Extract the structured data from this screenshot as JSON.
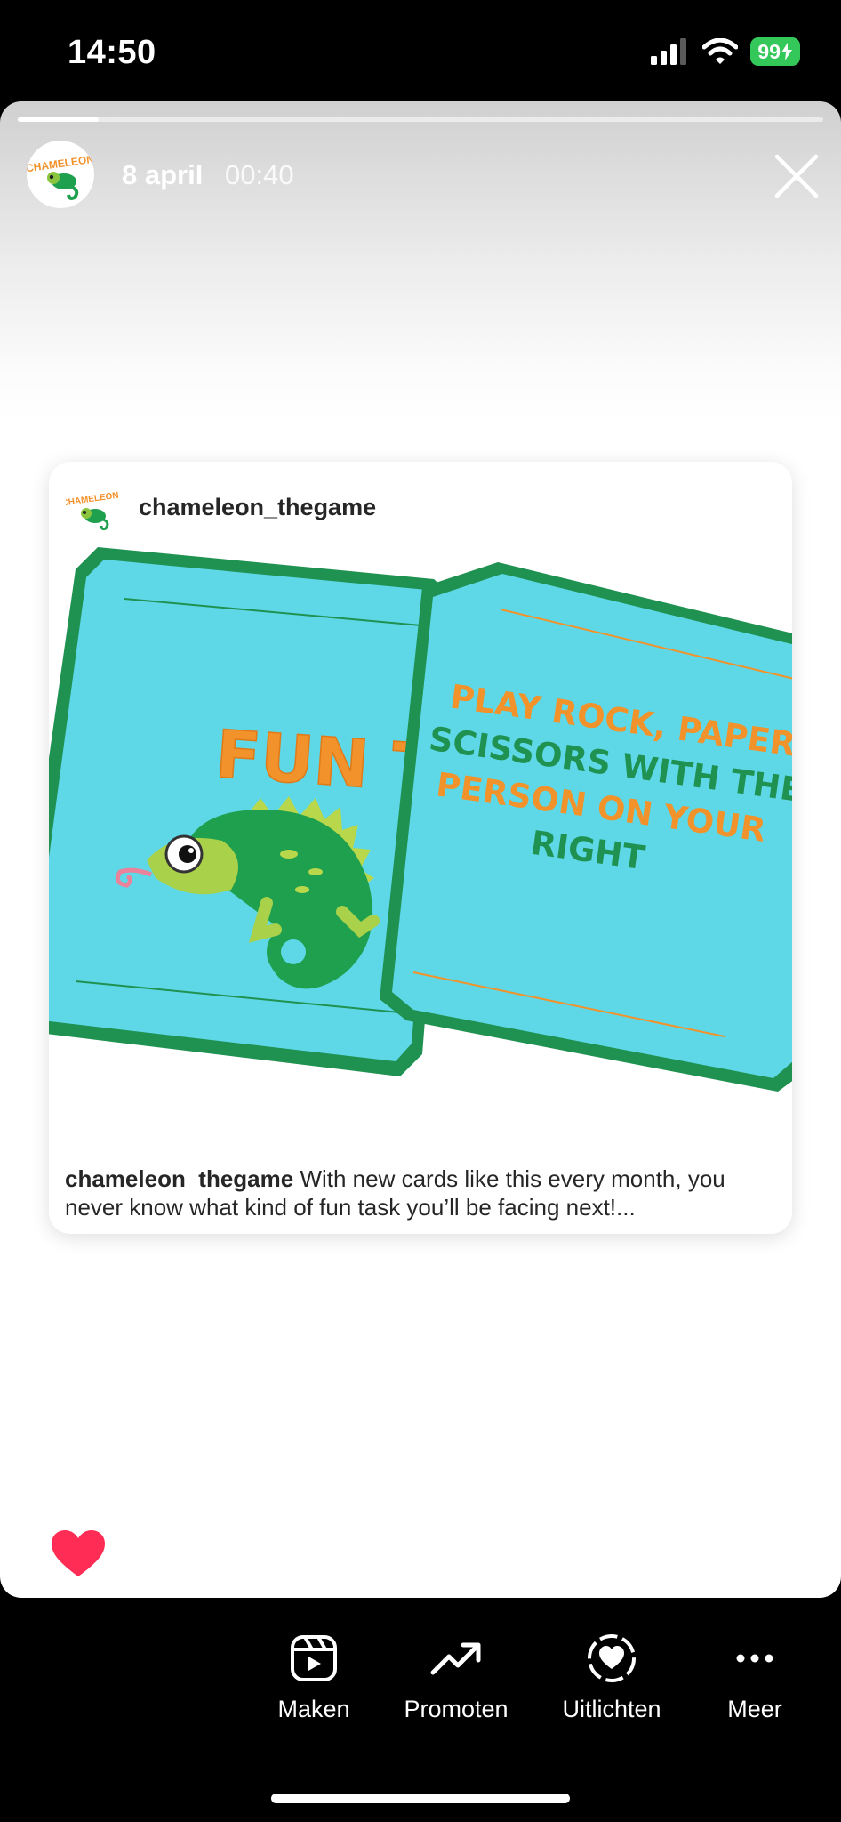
{
  "status_bar": {
    "time": "14:50",
    "battery": "99"
  },
  "story": {
    "progress": 0.1,
    "date": "8 april",
    "duration": "00:40",
    "avatar_alt": "CHAMELEON"
  },
  "post": {
    "username": "chameleon_thegame",
    "caption_user": "chameleon_thegame",
    "caption_text": " With new cards like this every month, you never know what kind of fun task you’ll be facing next!...",
    "card_left_title": "FUN TASK",
    "card_right_lines": [
      "PLAY ROCK, PAPER,",
      "SCISSORS WITH THE",
      "PERSON ON YOUR",
      "RIGHT"
    ]
  },
  "toolbar": {
    "items": [
      {
        "label": "Maken",
        "icon": "reels-icon"
      },
      {
        "label": "Promoten",
        "icon": "trending-icon"
      },
      {
        "label": "Uitlichten",
        "icon": "highlight-icon"
      },
      {
        "label": "Meer",
        "icon": "more-icon"
      }
    ]
  },
  "colors": {
    "card_fill": "#5ed8e6",
    "card_border": "#1f9150",
    "orange": "#f2922b",
    "heart": "#ff2d55",
    "battery": "#34c759"
  }
}
